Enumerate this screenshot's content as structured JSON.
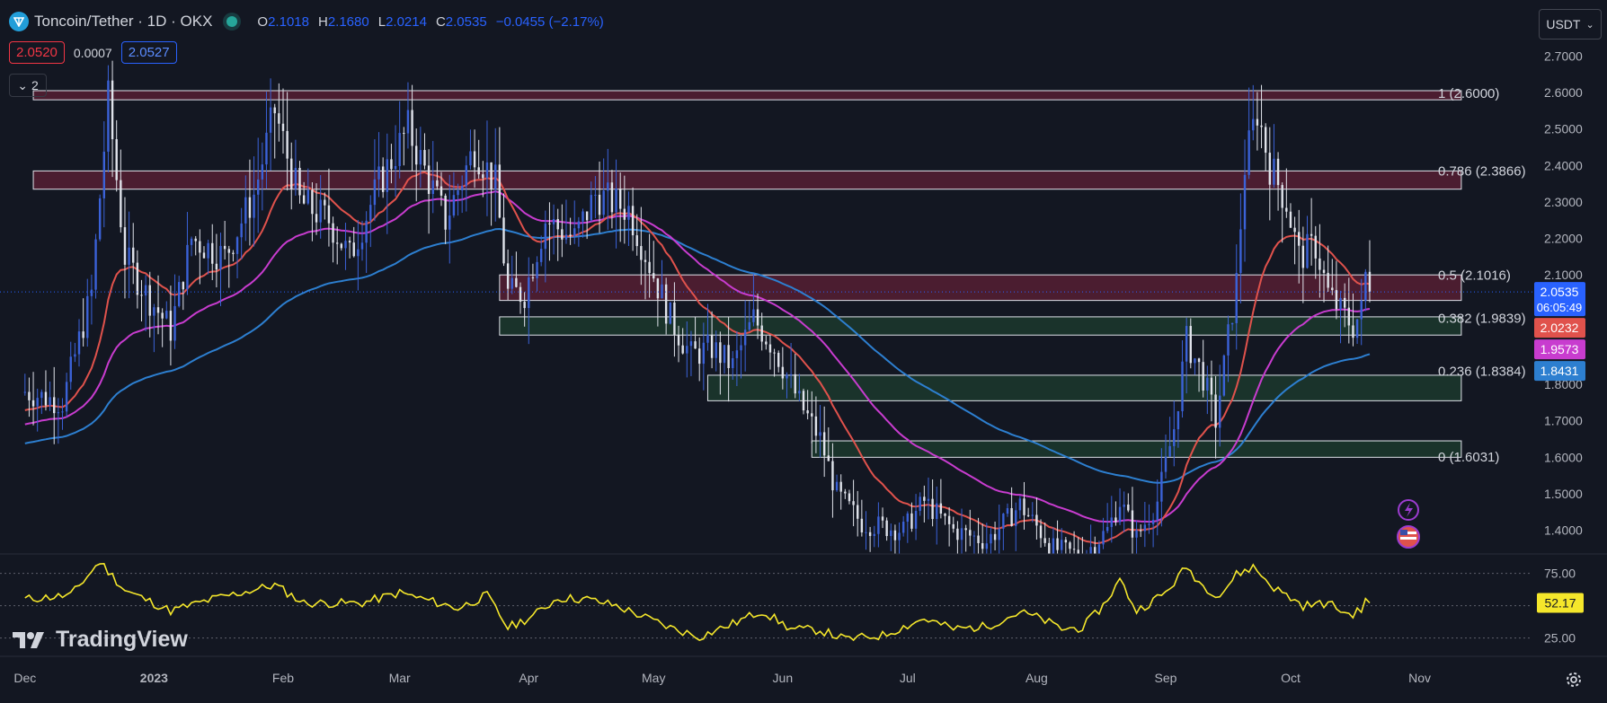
{
  "header": {
    "symbol": "Toncoin/Tether · 1D · OKX",
    "ohlc": [
      {
        "k": "O",
        "v": "2.1018"
      },
      {
        "k": "H",
        "v": "2.1680"
      },
      {
        "k": "L",
        "v": "2.0214"
      },
      {
        "k": "C",
        "v": "2.0535"
      }
    ],
    "change": "−0.0455 (−2.17%)",
    "bid": "2.0520",
    "spread": "0.0007",
    "ask": "2.0527",
    "indicators_collapsed": "2",
    "currency": "USDT",
    "brand": "TradingView"
  },
  "colors": {
    "up": "#3b62d8",
    "down": "#e0e3eb",
    "ema_fast": "#e0524c",
    "ema_mid": "#c83ccf",
    "ema_slow": "#2d7fd0",
    "rsi": "#f5e72b",
    "resistance": "#5a1f35",
    "support": "#1d3b2e"
  },
  "chart_data": [
    {
      "type": "candlestick",
      "ylim": [
        1.335,
        2.765
      ],
      "yticks": [
        "1.4000",
        "1.5000",
        "1.6000",
        "1.7000",
        "1.8000",
        "2.1000",
        "2.2000",
        "2.3000",
        "2.4000",
        "2.5000",
        "2.6000",
        "2.7000"
      ],
      "xticks": [
        "Dec",
        "2023",
        "Feb",
        "Mar",
        "Apr",
        "May",
        "Jun",
        "Jul",
        "Aug",
        "Sep",
        "Oct",
        "Nov"
      ],
      "ohlc_anchors_close": [
        [
          "2022-12-01",
          1.78
        ],
        [
          "2022-12-10",
          1.75
        ],
        [
          "2022-12-17",
          2.05
        ],
        [
          "2022-12-21",
          2.58
        ],
        [
          "2022-12-25",
          2.15
        ],
        [
          "2022-12-30",
          2.05
        ],
        [
          "2023-01-05",
          1.95
        ],
        [
          "2023-01-10",
          2.2
        ],
        [
          "2023-01-18",
          2.15
        ],
        [
          "2023-01-25",
          2.32
        ],
        [
          "2023-01-30",
          2.55
        ],
        [
          "2023-02-05",
          2.3
        ],
        [
          "2023-02-12",
          2.25
        ],
        [
          "2023-02-17",
          2.15
        ],
        [
          "2023-02-24",
          2.35
        ],
        [
          "2023-03-03",
          2.5
        ],
        [
          "2023-03-08",
          2.36
        ],
        [
          "2023-03-12",
          2.25
        ],
        [
          "2023-03-19",
          2.45
        ],
        [
          "2023-03-24",
          2.35
        ],
        [
          "2023-03-27",
          2.05
        ],
        [
          "2023-03-31",
          2.05
        ],
        [
          "2023-04-05",
          2.25
        ],
        [
          "2023-04-12",
          2.2
        ],
        [
          "2023-04-17",
          2.32
        ],
        [
          "2023-04-25",
          2.28
        ],
        [
          "2023-05-01",
          2.1
        ],
        [
          "2023-05-05",
          1.98
        ],
        [
          "2023-05-10",
          1.88
        ],
        [
          "2023-05-15",
          1.9
        ],
        [
          "2023-05-20",
          1.85
        ],
        [
          "2023-05-25",
          1.98
        ],
        [
          "2023-05-30",
          1.9
        ],
        [
          "2023-06-05",
          1.75
        ],
        [
          "2023-06-10",
          1.65
        ],
        [
          "2023-06-14",
          1.5
        ],
        [
          "2023-06-20",
          1.42
        ],
        [
          "2023-06-30",
          1.4
        ],
        [
          "2023-07-05",
          1.48
        ],
        [
          "2023-07-12",
          1.4
        ],
        [
          "2023-07-20",
          1.37
        ],
        [
          "2023-07-25",
          1.43
        ],
        [
          "2023-07-28",
          1.47
        ],
        [
          "2023-08-05",
          1.35
        ],
        [
          "2023-08-12",
          1.33
        ],
        [
          "2023-08-18",
          1.4
        ],
        [
          "2023-08-21",
          1.48
        ],
        [
          "2023-08-25",
          1.38
        ],
        [
          "2023-08-30",
          1.48
        ],
        [
          "2023-09-03",
          1.68
        ],
        [
          "2023-09-06",
          1.92
        ],
        [
          "2023-09-10",
          1.82
        ],
        [
          "2023-09-13",
          1.7
        ],
        [
          "2023-09-15",
          1.85
        ],
        [
          "2023-09-18",
          2.08
        ],
        [
          "2023-09-20",
          2.4
        ],
        [
          "2023-09-23",
          2.55
        ],
        [
          "2023-09-26",
          2.4
        ],
        [
          "2023-09-30",
          2.3
        ],
        [
          "2023-10-03",
          2.15
        ],
        [
          "2023-10-07",
          2.18
        ],
        [
          "2023-10-10",
          2.05
        ],
        [
          "2023-10-13",
          2.0
        ],
        [
          "2023-10-16",
          1.96
        ],
        [
          "2023-10-18",
          2.0
        ],
        [
          "2023-10-19",
          2.1
        ],
        [
          "2023-10-20",
          2.0535
        ]
      ]
    },
    {
      "type": "line",
      "name": "rsi",
      "ylim": [
        15,
        90
      ],
      "yticks": [
        "25.00",
        "75.00"
      ],
      "anchors": [
        [
          "2022-12-01",
          55
        ],
        [
          "2022-12-12",
          58
        ],
        [
          "2022-12-19",
          84
        ],
        [
          "2022-12-25",
          62
        ],
        [
          "2023-01-05",
          46
        ],
        [
          "2023-01-15",
          55
        ],
        [
          "2023-01-30",
          66
        ],
        [
          "2023-02-06",
          52
        ],
        [
          "2023-02-20",
          52
        ],
        [
          "2023-03-01",
          60
        ],
        [
          "2023-03-15",
          48
        ],
        [
          "2023-03-22",
          58
        ],
        [
          "2023-03-27",
          33
        ],
        [
          "2023-04-02",
          42
        ],
        [
          "2023-04-08",
          56
        ],
        [
          "2023-04-15",
          55
        ],
        [
          "2023-04-22",
          50
        ],
        [
          "2023-05-05",
          33
        ],
        [
          "2023-05-12",
          26
        ],
        [
          "2023-05-20",
          36
        ],
        [
          "2023-05-27",
          46
        ],
        [
          "2023-06-03",
          32
        ],
        [
          "2023-06-10",
          31
        ],
        [
          "2023-06-16",
          24
        ],
        [
          "2023-06-25",
          27
        ],
        [
          "2023-07-05",
          40
        ],
        [
          "2023-07-12",
          32
        ],
        [
          "2023-07-20",
          34
        ],
        [
          "2023-07-28",
          45
        ],
        [
          "2023-08-02",
          40
        ],
        [
          "2023-08-07",
          32
        ],
        [
          "2023-08-12",
          33
        ],
        [
          "2023-08-17",
          50
        ],
        [
          "2023-08-21",
          70
        ],
        [
          "2023-08-25",
          46
        ],
        [
          "2023-09-01",
          60
        ],
        [
          "2023-09-06",
          80
        ],
        [
          "2023-09-10",
          65
        ],
        [
          "2023-09-14",
          58
        ],
        [
          "2023-09-18",
          74
        ],
        [
          "2023-09-22",
          80
        ],
        [
          "2023-09-27",
          64
        ],
        [
          "2023-10-04",
          50
        ],
        [
          "2023-10-10",
          52
        ],
        [
          "2023-10-15",
          43
        ],
        [
          "2023-10-18",
          46
        ],
        [
          "2023-10-19",
          57
        ],
        [
          "2023-10-20",
          52.17
        ]
      ]
    }
  ],
  "right_axis_labels": [
    {
      "value": "2.0535",
      "sub": "06:05:49",
      "color": "#2962ff",
      "price": 2.0535
    },
    {
      "value": "2.0232",
      "color": "#e0524c",
      "price": 2.0232
    },
    {
      "value": "1.9573",
      "color": "#c83ccf",
      "price": 1.9573
    },
    {
      "value": "1.8431",
      "color": "#2d7fd0",
      "price": 1.8431
    }
  ],
  "rsi_last_label": "52.17",
  "fib_levels": [
    {
      "label": "1 (2.6000)",
      "price": 2.6
    },
    {
      "label": "0.786 (2.3866)",
      "price": 2.3866
    },
    {
      "label": "0.5 (2.1016)",
      "price": 2.1016
    },
    {
      "label": "0.382 (1.9839)",
      "price": 1.9839
    },
    {
      "label": "0.236 (1.8384)",
      "price": 1.8384
    },
    {
      "label": "0 (1.6031)",
      "price": 1.6031
    }
  ],
  "zones": [
    {
      "kind": "resistance",
      "from": "2022-12-03",
      "to": "2023-11-11",
      "top": 2.605,
      "bottom": 2.58
    },
    {
      "kind": "resistance",
      "from": "2022-12-03",
      "to": "2023-11-11",
      "top": 2.385,
      "bottom": 2.335
    },
    {
      "kind": "resistance",
      "from": "2023-03-25",
      "to": "2023-11-11",
      "top": 2.1,
      "bottom": 2.03
    },
    {
      "kind": "support",
      "from": "2023-03-25",
      "to": "2023-11-11",
      "top": 1.985,
      "bottom": 1.935
    },
    {
      "kind": "support",
      "from": "2023-05-14",
      "to": "2023-11-11",
      "top": 1.825,
      "bottom": 1.755
    },
    {
      "kind": "support",
      "from": "2023-06-08",
      "to": "2023-11-11",
      "top": 1.645,
      "bottom": 1.6
    }
  ]
}
